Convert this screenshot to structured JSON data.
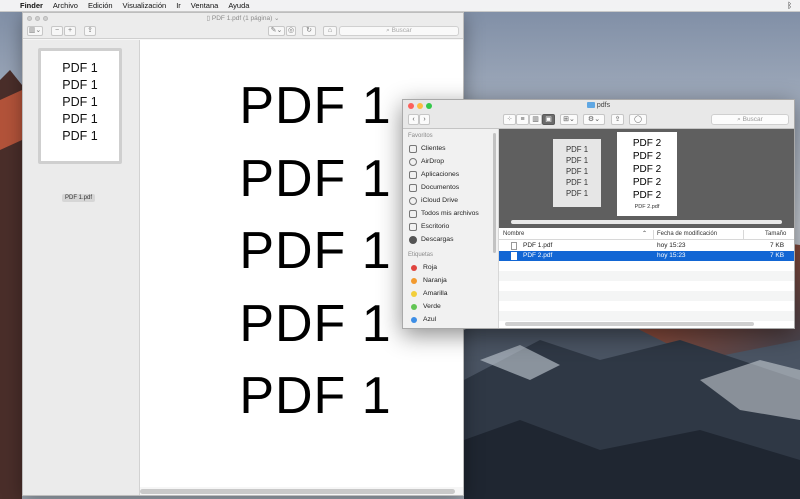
{
  "menubar": {
    "apple": "",
    "app": "Finder",
    "items": [
      "Archivo",
      "Edición",
      "Visualización",
      "Ir",
      "Ventana",
      "Ayuda"
    ],
    "status_icon": "bluetooth-icon"
  },
  "preview": {
    "title": "PDF 1.pdf (1 página)",
    "search_placeholder": "Buscar",
    "thumbnail_lines": [
      "PDF 1",
      "PDF 1",
      "PDF 1",
      "PDF 1",
      "PDF 1"
    ],
    "thumbnail_name": "PDF 1.pdf",
    "page_lines": [
      "PDF 1",
      "PDF 1",
      "PDF 1",
      "PDF 1",
      "PDF 1"
    ]
  },
  "finder": {
    "title": "pdfs",
    "search_placeholder": "Buscar",
    "sidebar": {
      "favorites_header": "Favoritos",
      "favorites": [
        {
          "label": "Clientes",
          "icon": "folder-icon"
        },
        {
          "label": "AirDrop",
          "icon": "airdrop-icon"
        },
        {
          "label": "Aplicaciones",
          "icon": "applications-icon"
        },
        {
          "label": "Documentos",
          "icon": "documents-icon"
        },
        {
          "label": "iCloud Drive",
          "icon": "cloud-icon"
        },
        {
          "label": "Todos mis archivos",
          "icon": "all-files-icon"
        },
        {
          "label": "Escritorio",
          "icon": "desktop-icon"
        },
        {
          "label": "Descargas",
          "icon": "downloads-icon"
        }
      ],
      "tags_header": "Etiquetas",
      "tags": [
        {
          "label": "Roja",
          "color": "#e0443e"
        },
        {
          "label": "Naranja",
          "color": "#f29a2e"
        },
        {
          "label": "Amarilla",
          "color": "#f2cf3b"
        },
        {
          "label": "Verde",
          "color": "#62c554"
        },
        {
          "label": "Azul",
          "color": "#3d8ee6"
        }
      ]
    },
    "cover_flow": {
      "left_lines": [
        "PDF 1",
        "PDF 1",
        "PDF 1",
        "PDF 1",
        "PDF 1"
      ],
      "right_lines": [
        "PDF 2",
        "PDF 2",
        "PDF 2",
        "PDF 2",
        "PDF 2"
      ],
      "right_name": "PDF 2.pdf"
    },
    "list": {
      "columns": {
        "name": "Nombre",
        "date": "Fecha de modificación",
        "size": "Tamaño"
      },
      "rows": [
        {
          "name": "PDF 1.pdf",
          "date": "hoy 15:23",
          "size": "7 KB",
          "selected": false
        },
        {
          "name": "PDF 2.pdf",
          "date": "hoy 15:23",
          "size": "7 KB",
          "selected": true
        }
      ]
    },
    "traffic_lights": [
      "#fc605b",
      "#fdbc40",
      "#34c84a"
    ],
    "selection_color": "#1266d4"
  }
}
